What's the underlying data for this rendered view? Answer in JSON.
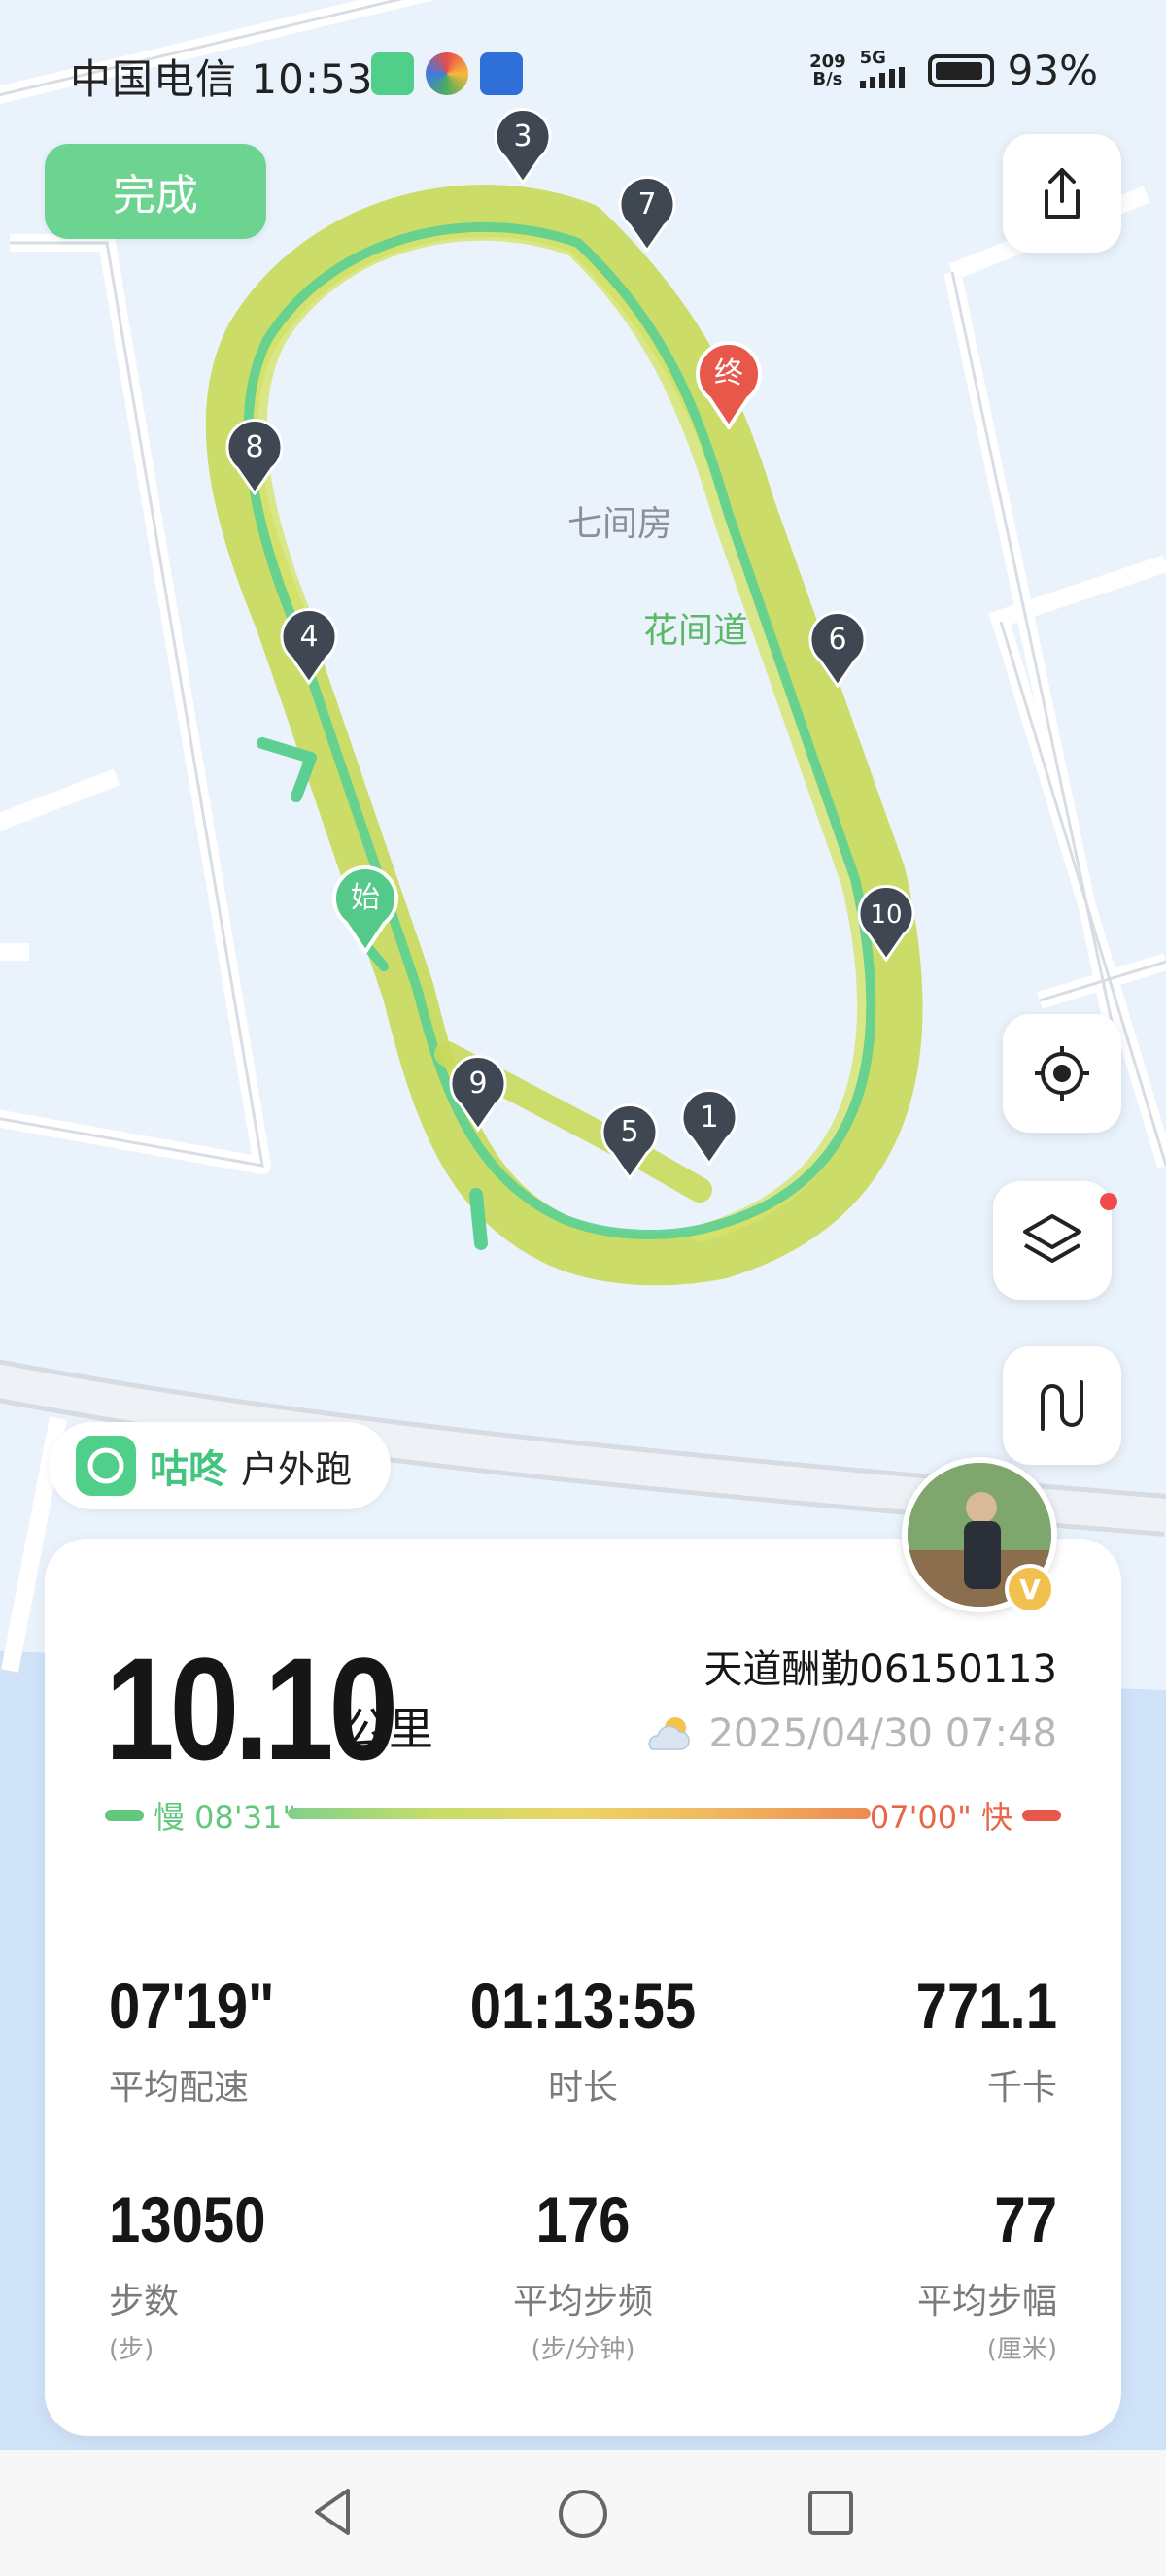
{
  "status_bar": {
    "carrier": "中国电信",
    "time": "10:53",
    "net_speed_value": "209",
    "net_speed_unit": "B/s",
    "net_type": "5G",
    "battery": "93%",
    "battery_level": 0.93
  },
  "toolbar": {
    "done_label": "完成"
  },
  "map": {
    "place_labels": {
      "area": "七间房",
      "park": "花间道"
    },
    "start_label": "始",
    "end_label": "终",
    "km_markers": [
      "1",
      "3",
      "4",
      "5",
      "6",
      "7",
      "8",
      "9",
      "10"
    ],
    "colors": {
      "track_outer": "#c9da5b",
      "track_inner": "#5ccf92",
      "start": "#55c98a",
      "end": "#e8584a",
      "marker": "#3f4752"
    }
  },
  "brand": {
    "name": "咕咚",
    "mode": "户外跑"
  },
  "summary": {
    "distance": "10.10",
    "distance_unit": "公里",
    "username": "天道酬勤06150113",
    "datetime": "2025/04/30 07:48",
    "pace_slow": "慢 08'31\"",
    "pace_fast": "07'00\" 快",
    "avatar_badge": "V"
  },
  "stats": [
    {
      "value": "07'19\"",
      "label": "平均配速",
      "sub": ""
    },
    {
      "value": "01:13:55",
      "label": "时长",
      "sub": ""
    },
    {
      "value": "771.1",
      "label": "千卡",
      "sub": ""
    },
    {
      "value": "13050",
      "label": "步数",
      "sub": "(步)"
    },
    {
      "value": "176",
      "label": "平均步频",
      "sub": "(步/分钟)"
    },
    {
      "value": "77",
      "label": "平均步幅",
      "sub": "(厘米)"
    }
  ]
}
